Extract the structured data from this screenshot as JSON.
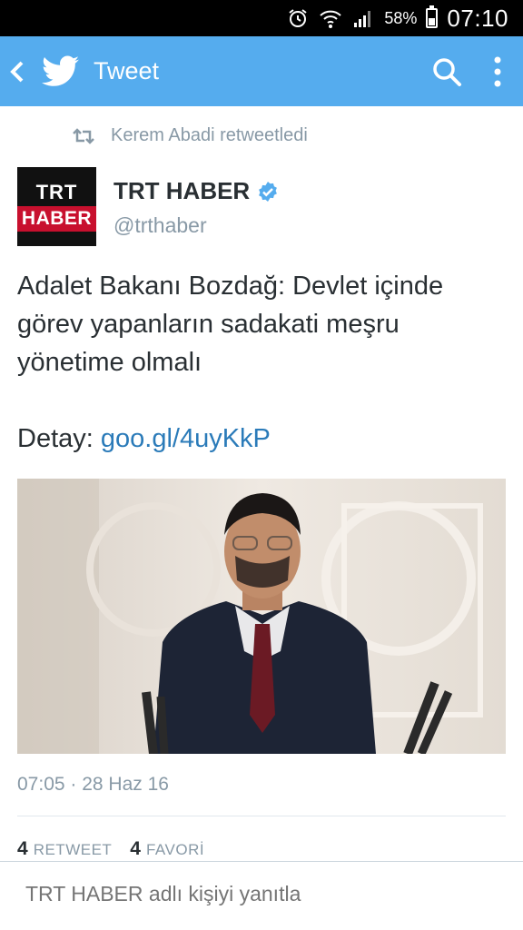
{
  "status_bar": {
    "battery": "58%",
    "battery_level": 0.58,
    "time": "07:10"
  },
  "app_bar": {
    "title": "Tweet",
    "color": "#55acee"
  },
  "retweet_info": {
    "text": "Kerem Abadi retweetledi"
  },
  "tweet": {
    "avatar": {
      "line1": "TRT",
      "line2": "HABER"
    },
    "display_name": "TRT HABER",
    "verified": true,
    "handle": "@trthaber",
    "text": "Adalet Bakanı Bozdağ: Devlet içinde görev yapanların sadakati meşru yönetime olmalı",
    "detail_prefix": "Detay: ",
    "link": "goo.gl/4uyKkP",
    "timestamp": "07:05 · 28 Haz 16",
    "retweet_count": "4",
    "retweet_label": "RETWEET",
    "favorite_count": "4",
    "favorite_label": "FAVORİ"
  },
  "reply": {
    "placeholder": "TRT HABER adlı kişiyi yanıtla"
  },
  "colors": {
    "accent": "#55acee",
    "link": "#2b7bb9",
    "muted": "#8899a6",
    "text": "#292f33",
    "brand_red": "#c8102e"
  }
}
